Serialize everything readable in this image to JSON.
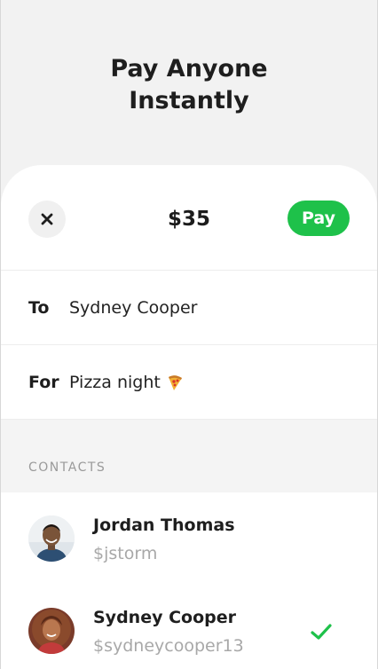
{
  "hero": {
    "line1": "Pay Anyone",
    "line2": "Instantly"
  },
  "payment": {
    "amount": "$35",
    "pay_label": "Pay",
    "to_label": "To",
    "to_value": "Sydney Cooper",
    "for_label": "For",
    "for_value": "Pizza night",
    "for_emoji_icon": "pizza-icon"
  },
  "contacts": {
    "title": "CONTACTS",
    "items": [
      {
        "name": "Jordan Thomas",
        "handle": "$jstorm",
        "selected": false
      },
      {
        "name": "Sydney Cooper",
        "handle": "$sydneycooper13",
        "selected": true
      }
    ]
  },
  "colors": {
    "accent": "#1ec14a",
    "background": "#f2f2f2",
    "sheet": "#ffffff",
    "muted_text": "#a8a8a8"
  }
}
